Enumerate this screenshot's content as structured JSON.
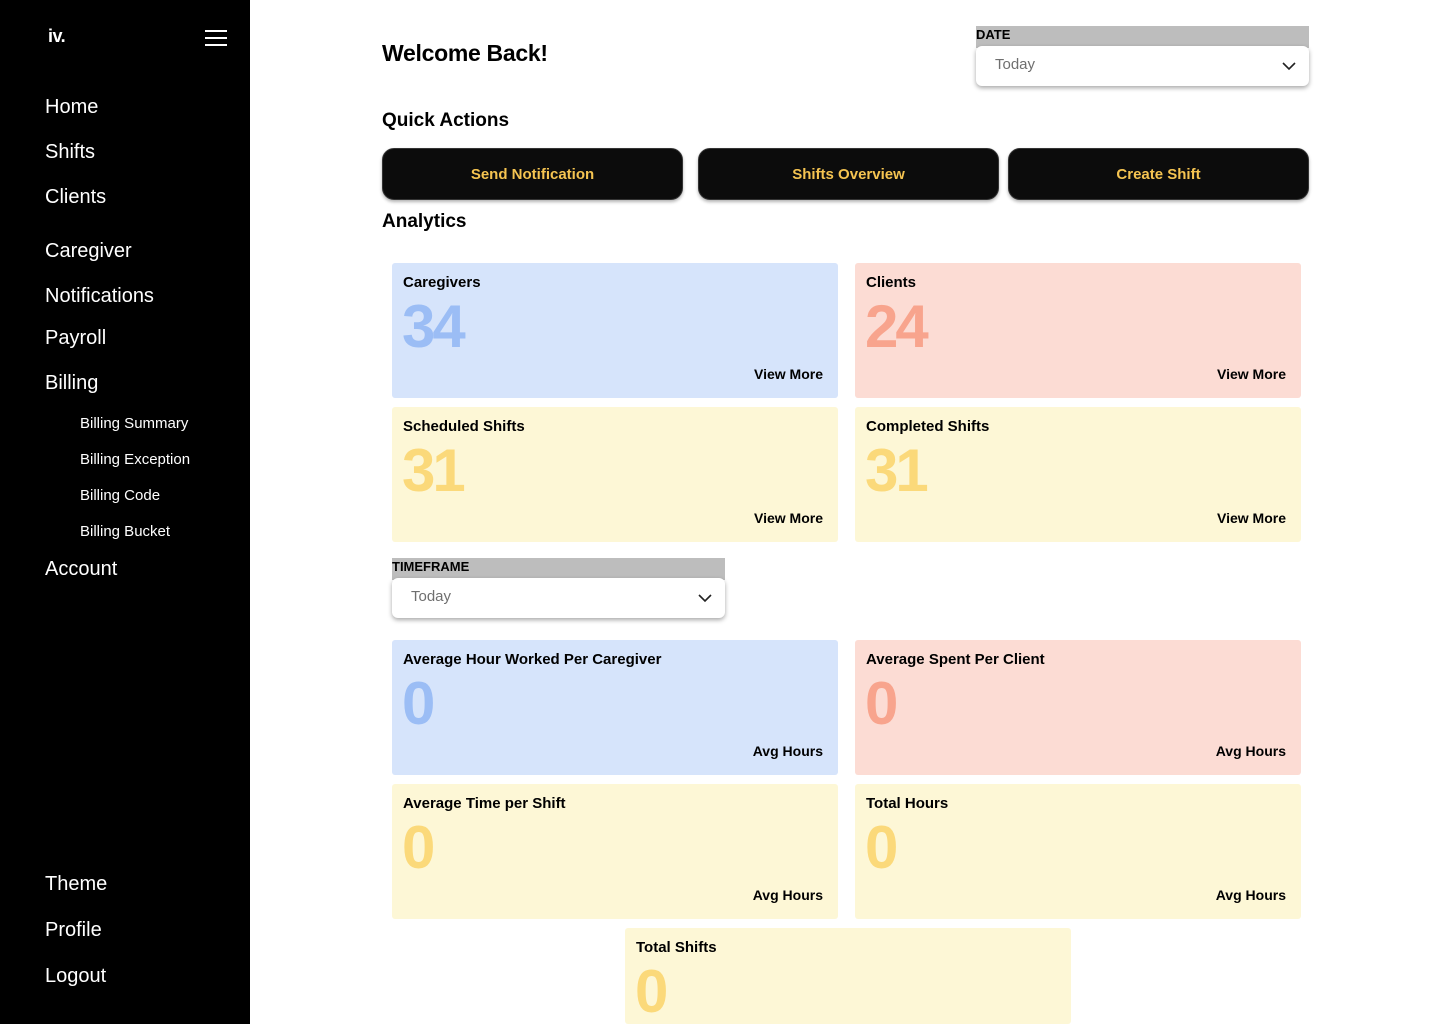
{
  "sidebar": {
    "logo": "iv.",
    "nav": [
      "Home",
      "Shifts",
      "Clients",
      "Caregiver",
      "Notifications",
      "Payroll",
      "Billing"
    ],
    "billing_sub": [
      "Billing Summary",
      "Billing Exception",
      "Billing Code",
      "Billing Bucket"
    ],
    "account": "Account",
    "bottom": [
      "Theme",
      "Profile",
      "Logout"
    ]
  },
  "header": {
    "welcome": "Welcome Back!",
    "date_label": "DATE",
    "date_value": "Today"
  },
  "quick_actions": {
    "title": "Quick Actions",
    "buttons": [
      "Send Notification",
      "Shifts Overview",
      "Create Shift"
    ]
  },
  "analytics": {
    "title": "Analytics",
    "top_cards": [
      {
        "title": "Caregivers",
        "value": "34",
        "link": "View More",
        "color": "#d6e4fb"
      },
      {
        "title": "Clients",
        "value": "24",
        "link": "View More",
        "color": "#fcdcd4"
      },
      {
        "title": "Scheduled Shifts",
        "value": "31",
        "link": "View More",
        "color": "#fdf7d6"
      },
      {
        "title": "Completed Shifts",
        "value": "31",
        "link": "View More",
        "color": "#fdf7d6"
      }
    ],
    "timeframe_label": "TIMEFRAME",
    "timeframe_value": "Today",
    "bottom_cards": [
      {
        "title": "Average Hour Worked Per Caregiver",
        "value": "0",
        "unit": "Avg Hours"
      },
      {
        "title": "Average Spent Per Client",
        "value": "0",
        "unit": "Avg Hours"
      },
      {
        "title": "Average Time per Shift",
        "value": "0",
        "unit": "Avg Hours"
      },
      {
        "title": "Total Hours",
        "value": "0",
        "unit": "Avg Hours"
      },
      {
        "title": "Total Shifts",
        "value": "0"
      }
    ]
  },
  "colors": {
    "accent": "#f5c451",
    "sidebar_bg": "#000000",
    "blue_card": "#d6e4fb",
    "pink_card": "#fcdcd4",
    "yellow_card": "#fdf7d6"
  },
  "icons": {
    "menu": "hamburger-menu-icon",
    "dropdown": "chevron-down-icon"
  }
}
